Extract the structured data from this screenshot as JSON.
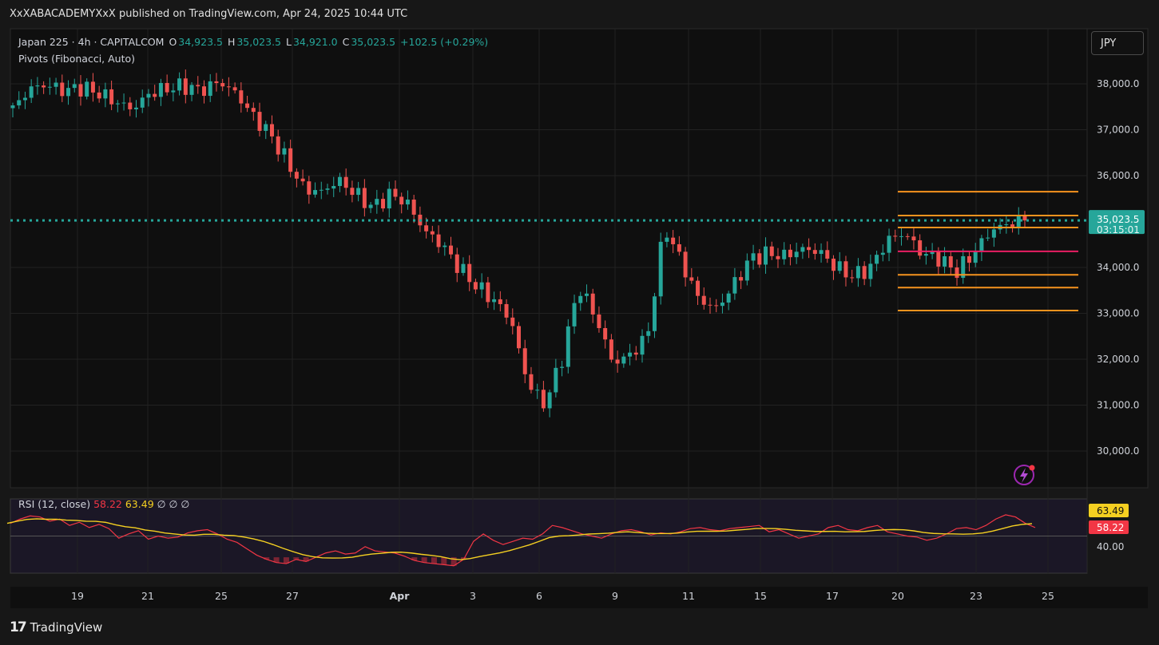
{
  "publish_info": "XxXABACADEMYXxX published on TradingView.com, Apr 24, 2025 10:44 UTC",
  "legend": {
    "symbol": "Japan 225 · 4h · CAPITALCOM",
    "o_label": "O",
    "o_value": "34,923.5",
    "h_label": "H",
    "h_value": "35,023.5",
    "l_label": "L",
    "l_value": "34,921.0",
    "c_label": "C",
    "c_value": "35,023.5",
    "change": "+102.5 (+0.29%)",
    "indicator": "Pivots (Fibonacci, Auto)"
  },
  "currency_button": "JPY",
  "price_tag": {
    "price": "35,023.5",
    "countdown": "03:15:01"
  },
  "rsi_legend": {
    "name": "RSI (12, close)",
    "rsi_value": "58.22",
    "ma_value": "63.49",
    "extra": "∅ ∅ ∅"
  },
  "footer_brand": "TradingView",
  "colors": {
    "up": "#26a69a",
    "down": "#ef5350",
    "pivot": "#f7931e",
    "pivot_p": "#e91e63",
    "rsi": "#f23645",
    "rsi_ma": "#f5d021",
    "background": "#171717",
    "panel": "#0f0f0f"
  },
  "chart_data": [
    {
      "type": "candlestick",
      "title": "Japan 225 · 4h · CAPITALCOM",
      "y_ticks": [
        "38,000.0",
        "37,000.0",
        "36,000.0",
        "34,000.0",
        "33,000.0",
        "32,000.0",
        "31,000.0",
        "30,000.0"
      ],
      "y_tick_values": [
        38000,
        37000,
        36000,
        34000,
        33000,
        32000,
        31000,
        30000
      ],
      "ylim": [
        29200,
        39200
      ],
      "x_ticks": [
        "19",
        "21",
        "25",
        "27",
        "Apr",
        "3",
        "6",
        "9",
        "11",
        "15",
        "17",
        "20",
        "23",
        "25"
      ],
      "last_price": 35023.5,
      "pivots": {
        "levels": [
          35650,
          35130,
          34870,
          34350,
          33840,
          33560,
          33060
        ],
        "p_level": 34350
      },
      "close_path": [
        37450,
        37900,
        37980,
        37850,
        37920,
        37800,
        37600,
        37450,
        37800,
        37900,
        37950,
        37850,
        38050,
        37800,
        37300,
        36900,
        36300,
        35700,
        35650,
        35900,
        35600,
        35300,
        35600,
        35400,
        34800,
        34500,
        34000,
        33600,
        33300,
        32900,
        31500,
        31000,
        32000,
        33600,
        32900,
        31900,
        32100,
        32500,
        34900,
        34100,
        33300,
        33100,
        33600,
        34200,
        34300,
        34250,
        34400,
        34350,
        34000,
        33800,
        34000,
        34600,
        34750,
        34300,
        34200,
        33900,
        34300,
        34800,
        34950,
        35023.5
      ],
      "rsi": {
        "name": "RSI (12, close)",
        "value": 58.22,
        "ma_value": 63.49,
        "ylim": [
          15,
          85
        ],
        "tick": "40.00",
        "mid_level": 50,
        "values": [
          62,
          66,
          69,
          68,
          64,
          66,
          60,
          63,
          58,
          61,
          57,
          48,
          52,
          55,
          47,
          50,
          48,
          49,
          53,
          55,
          56,
          52,
          47,
          44,
          38,
          32,
          28,
          25,
          24,
          28,
          26,
          30,
          34,
          36,
          33,
          34,
          40,
          36,
          35,
          34,
          31,
          27,
          25,
          24,
          23,
          22,
          28,
          45,
          52,
          46,
          42,
          45,
          48,
          47,
          52,
          60,
          58,
          55,
          52,
          50,
          48,
          52,
          55,
          56,
          54,
          51,
          53,
          52,
          54,
          57,
          58,
          56,
          55,
          57,
          58,
          59,
          60,
          54,
          56,
          52,
          48,
          50,
          52,
          58,
          60,
          56,
          55,
          58,
          60,
          54,
          52,
          50,
          49,
          46,
          48,
          52,
          57,
          58,
          56,
          60,
          66,
          70,
          68,
          62,
          58
        ]
      }
    }
  ]
}
